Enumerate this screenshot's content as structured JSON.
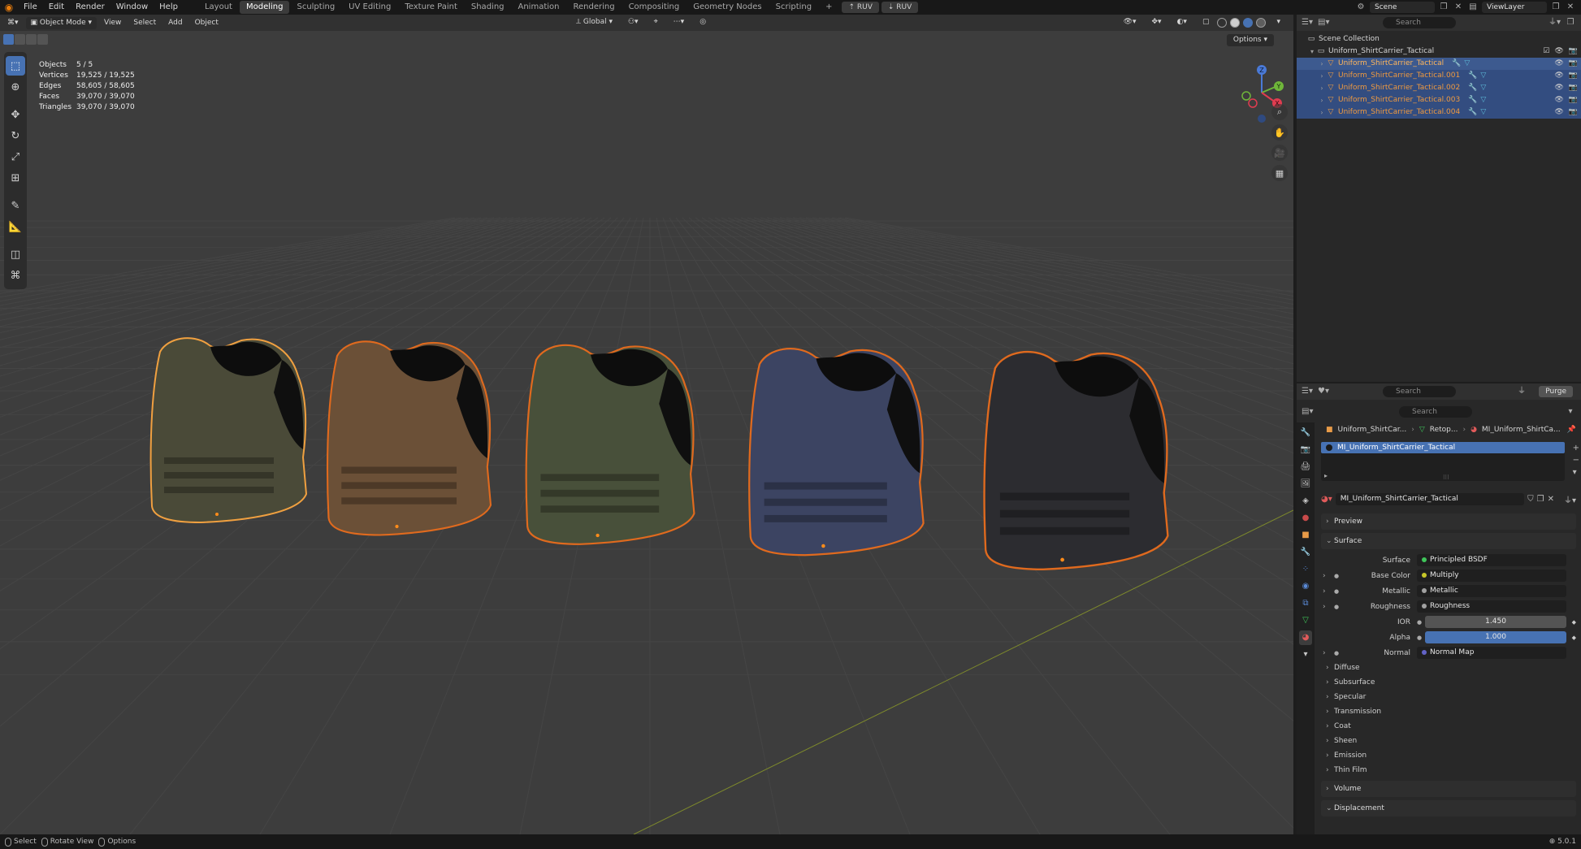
{
  "topbar": {
    "menus": [
      "File",
      "Edit",
      "Render",
      "Window",
      "Help"
    ],
    "workspaces": [
      "Layout",
      "Modeling",
      "Sculpting",
      "UV Editing",
      "Texture Paint",
      "Shading",
      "Animation",
      "Rendering",
      "Compositing",
      "Geometry Nodes",
      "Scripting"
    ],
    "active_workspace": "Modeling",
    "add_tab": "+",
    "ruv1": "RUV",
    "ruv2": "RUV",
    "scene": "Scene",
    "view_layer": "ViewLayer"
  },
  "viewport": {
    "mode": "Object Mode",
    "menus": [
      "View",
      "Select",
      "Add",
      "Object"
    ],
    "orientation": "Global",
    "options": "Options",
    "stats": [
      {
        "label": "Objects",
        "value": "5 / 5"
      },
      {
        "label": "Vertices",
        "value": "19,525 / 19,525"
      },
      {
        "label": "Edges",
        "value": "58,605 / 58,605"
      },
      {
        "label": "Faces",
        "value": "39,070 / 39,070"
      },
      {
        "label": "Triangles",
        "value": "39,070 / 39,070"
      }
    ],
    "gizmo": {
      "z": "Z",
      "y": "Y",
      "x": "X"
    },
    "vests": [
      {
        "color": "#4a4a38",
        "outline": "#f0a040"
      },
      {
        "color": "#6b5037",
        "outline": "#e06a1e"
      },
      {
        "color": "#48503a",
        "outline": "#e06a1e"
      },
      {
        "color": "#3c4462",
        "outline": "#e06a1e"
      },
      {
        "color": "#2c2c30",
        "outline": "#e06a1e"
      }
    ]
  },
  "outliner": {
    "search_placeholder": "Search",
    "root": "Scene Collection",
    "collection": "Uniform_ShirtCarrier_Tactical",
    "objects": [
      "Uniform_ShirtCarrier_Tactical",
      "Uniform_ShirtCarrier_Tactical.001",
      "Uniform_ShirtCarrier_Tactical.002",
      "Uniform_ShirtCarrier_Tactical.003",
      "Uniform_ShirtCarrier_Tactical.004"
    ]
  },
  "properties": {
    "search1": "Search",
    "purge": "Purge",
    "search2": "Search",
    "breadcrumb": [
      "Uniform_ShirtCar...",
      "Retop...",
      "MI_Uniform_ShirtCa..."
    ],
    "slot": "MI_Uniform_ShirtCarrier_Tactical",
    "material": "MI_Uniform_ShirtCarrier_Tactical",
    "preview": "Preview",
    "surface_panel": "Surface",
    "rows": [
      {
        "label": "Surface",
        "value": "Principled BSDF",
        "dot": "#3fc55a"
      },
      {
        "label": "Base Color",
        "value": "Multiply",
        "dot": "#c7c729"
      },
      {
        "label": "Metallic",
        "value": "Metallic",
        "dot": "#a1a1a1"
      },
      {
        "label": "Roughness",
        "value": "Roughness",
        "dot": "#a1a1a1"
      }
    ],
    "ior": {
      "label": "IOR",
      "value": "1.450"
    },
    "alpha": {
      "label": "Alpha",
      "value": "1.000"
    },
    "normal": {
      "label": "Normal",
      "value": "Normal Map",
      "dot": "#6363c7"
    },
    "subpanels": [
      "Diffuse",
      "Subsurface",
      "Specular",
      "Transmission",
      "Coat",
      "Sheen",
      "Emission",
      "Thin Film"
    ],
    "volume": "Volume",
    "displacement": "Displacement"
  },
  "statusbar": {
    "select": "Select",
    "rotate": "Rotate View",
    "options": "Options",
    "version": "5.0.1"
  }
}
